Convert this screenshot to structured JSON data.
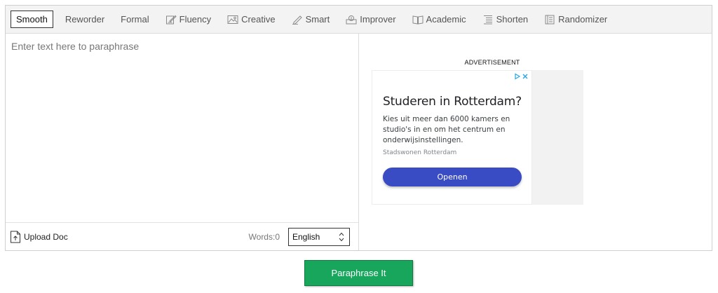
{
  "modes": [
    {
      "label": "Smooth",
      "icon": "",
      "active": true
    },
    {
      "label": "Reworder",
      "icon": ""
    },
    {
      "label": "Formal",
      "icon": ""
    },
    {
      "label": "Fluency",
      "icon": "pencil-note-icon"
    },
    {
      "label": "Creative",
      "icon": "picture-icon"
    },
    {
      "label": "Smart",
      "icon": "pen-icon"
    },
    {
      "label": "Improver",
      "icon": "lightbulb-icon"
    },
    {
      "label": "Academic",
      "icon": "book-icon"
    },
    {
      "label": "Shorten",
      "icon": "lines-icon"
    },
    {
      "label": "Randomizer",
      "icon": "list-icon"
    }
  ],
  "editor": {
    "placeholder": "Enter text here to paraphrase",
    "value": ""
  },
  "footer": {
    "upload_label": "Upload Doc",
    "words_label": "Words:0",
    "language": "English"
  },
  "ad": {
    "label": "ADVERTISEMENT",
    "title": "Studeren in Rotterdam?",
    "description": "Kies uit meer dan 6000 kamers en studio's in en om het centrum en onderwijsinstellingen.",
    "source": "Stadswonen Rotterdam",
    "button_label": "Openen",
    "button_color": "#3a4cc4"
  },
  "submit": {
    "label": "Paraphrase It",
    "color": "#17a65c"
  }
}
